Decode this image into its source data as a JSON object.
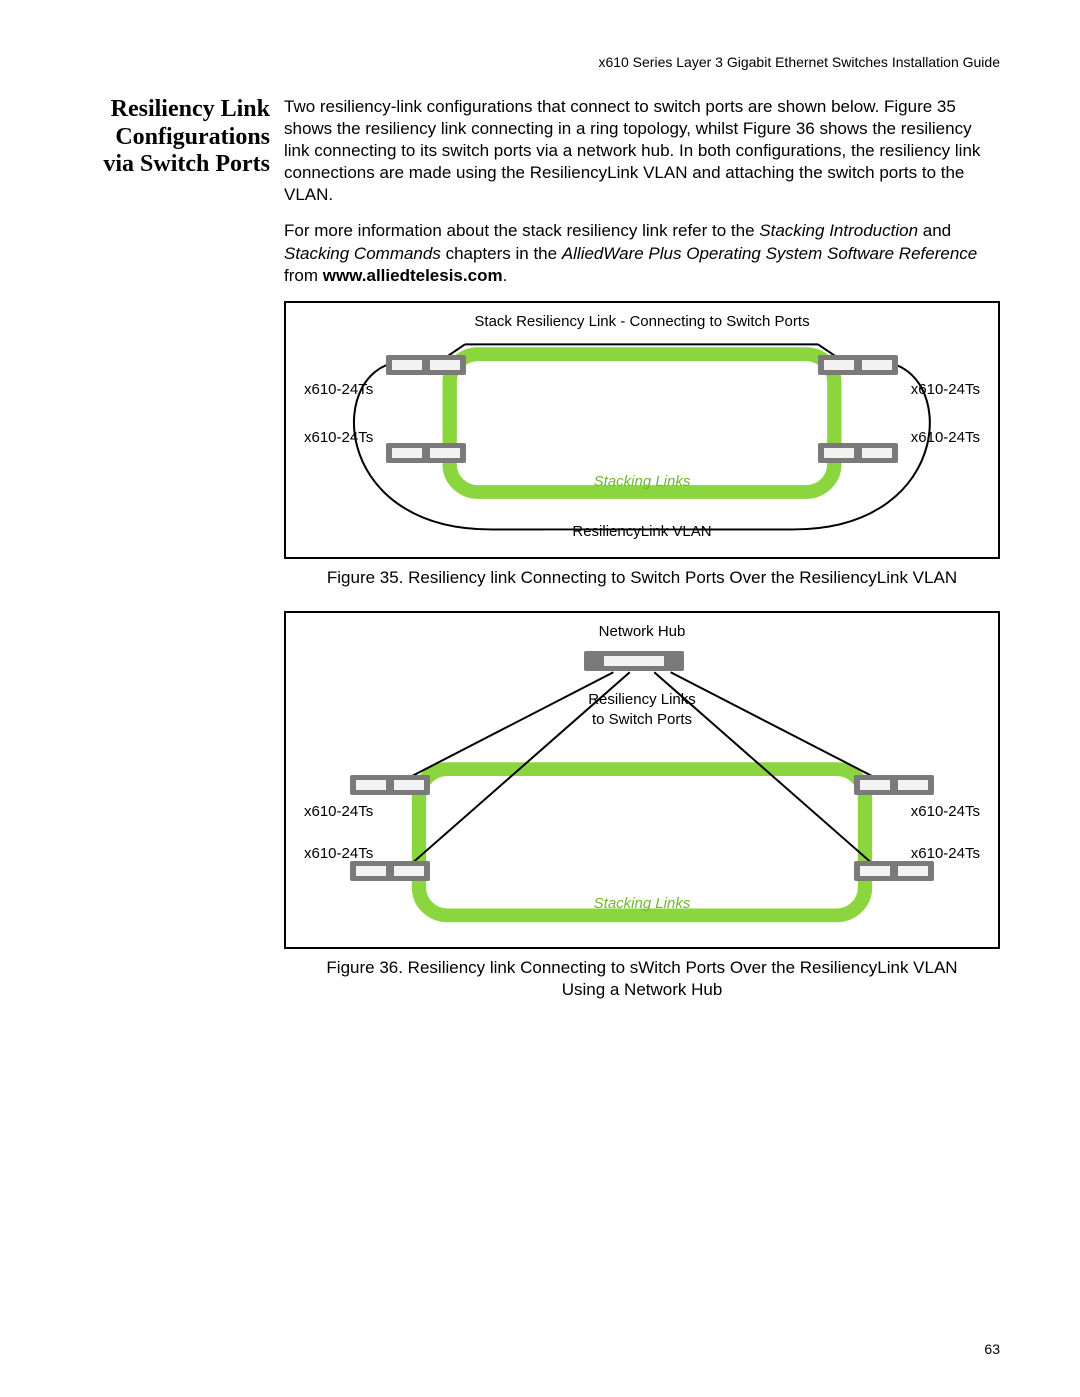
{
  "header": {
    "running_title": "x610 Series Layer 3 Gigabit Ethernet Switches Installation Guide"
  },
  "side_heading": "Resiliency Link Configurations via Switch Ports",
  "para1": "Two resiliency-link configurations that connect to switch ports are shown below. Figure 35 shows the resiliency link connecting in a ring topology, whilst Figure 36 shows the resiliency link connecting to its switch ports via a network hub. In both configurations, the resiliency link connections are made using the ResiliencyLink VLAN and attaching the switch ports to the VLAN.",
  "para2_lead": "For more information about the stack resiliency link refer to the ",
  "para2_i1": "Stacking Introduction",
  "para2_mid1": " and ",
  "para2_i2": "Stacking Commands",
  "para2_mid2": " chapters in the ",
  "para2_i3": "AlliedWare Plus Operating System Software Reference",
  "para2_mid3": " from ",
  "para2_bold": "www.alliedtelesis.com",
  "para2_end": ".",
  "fig35": {
    "title": "Stack Resiliency Link - Connecting to Switch Ports",
    "sw_tl": "x610-24Ts",
    "sw_tr": "x610-24Ts",
    "sw_bl": "x610-24Ts",
    "sw_br": "x610-24Ts",
    "stacking": "Stacking Links",
    "vlan": "ResiliencyLink VLAN",
    "caption": "Figure 35. Resiliency link Connecting to Switch Ports Over the ResiliencyLink VLAN"
  },
  "fig36": {
    "hub": "Network Hub",
    "links_line1": "Resiliency Links",
    "links_line2": "to Switch Ports",
    "sw_tl": "x610-24Ts",
    "sw_tr": "x610-24Ts",
    "sw_bl": "x610-24Ts",
    "sw_br": "x610-24Ts",
    "stacking": "Stacking Links",
    "caption": "Figure 36. Resiliency link Connecting to sWitch Ports Over the ResiliencyLink VLAN Using a Network Hub"
  },
  "page_number": "63"
}
